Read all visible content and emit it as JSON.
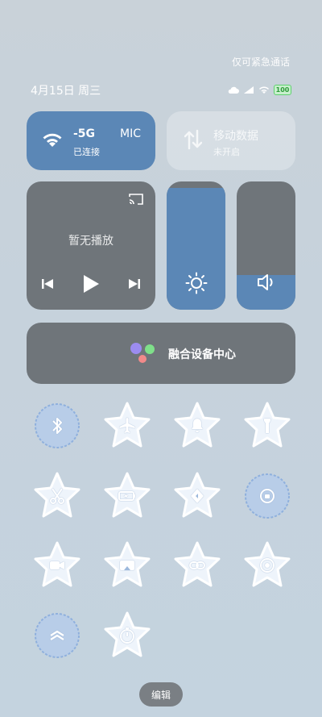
{
  "header": {
    "emergency_text": "仅可紧急通话",
    "date_text": "4月15日 周三",
    "battery_text": "100"
  },
  "wifi": {
    "ssid": "-5G",
    "extra": "MIC",
    "status": "已连接",
    "color": "#5b87b6"
  },
  "mobile_data": {
    "label": "移动数据",
    "status": "未开启"
  },
  "media": {
    "title": "暂无播放"
  },
  "brightness": {
    "level": 0.95
  },
  "volume": {
    "level": 0.27
  },
  "device_hub": {
    "label": "融合设备中心"
  },
  "toggles": [
    {
      "icon": "bluetooth-icon",
      "state": "active"
    },
    {
      "icon": "airplane-icon",
      "state": "inactive"
    },
    {
      "icon": "bell-icon",
      "state": "inactive"
    },
    {
      "icon": "flashlight-icon",
      "state": "inactive"
    },
    {
      "icon": "scissors-icon",
      "state": "inactive"
    },
    {
      "icon": "battery-saver-icon",
      "state": "inactive"
    },
    {
      "icon": "location-icon",
      "state": "inactive"
    },
    {
      "icon": "rotation-lock-icon",
      "state": "active"
    },
    {
      "icon": "video-camera-icon",
      "state": "inactive"
    },
    {
      "icon": "screen-mirror-icon",
      "state": "inactive"
    },
    {
      "icon": "link-icon",
      "state": "inactive"
    },
    {
      "icon": "focus-mode-icon",
      "state": "inactive"
    },
    {
      "icon": "chevron-stack-icon",
      "state": "active"
    },
    {
      "icon": "timer-icon",
      "state": "inactive"
    }
  ],
  "edit_button": {
    "label": "编辑"
  },
  "colors": {
    "accent": "#5b87b6",
    "tile_dark": "#6f757a",
    "star_fill": "#eef4fb",
    "star_stroke": "#ffffff",
    "active_blob": "#b8cde8"
  }
}
